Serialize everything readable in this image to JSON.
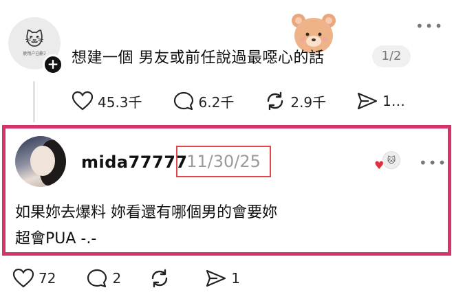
{
  "colors": {
    "highlight_border": "#d6336c",
    "date_box": "#e04848",
    "like_red": "#e0303f"
  },
  "top_post": {
    "title": "想建一個 男友或前任說過最噁心的話",
    "page_indicator": "1/2",
    "avatar_caption": "使用户已删7",
    "stats": {
      "likes": "45.3千",
      "comments": "6.2千",
      "reposts": "2.9千",
      "shares": "1…"
    }
  },
  "reply": {
    "username": "mida77777",
    "date": "11/30/25",
    "text_lines": [
      "如果妳去爆料 妳看還有哪個男的會要妳",
      "超會PUA -.-"
    ],
    "stats": {
      "likes": "72",
      "comments": "2",
      "shares": "1"
    }
  },
  "icons": [
    "plus-icon",
    "heart-icon",
    "comment-icon",
    "repost-icon",
    "share-icon",
    "more-icon",
    "bear-sticker"
  ]
}
